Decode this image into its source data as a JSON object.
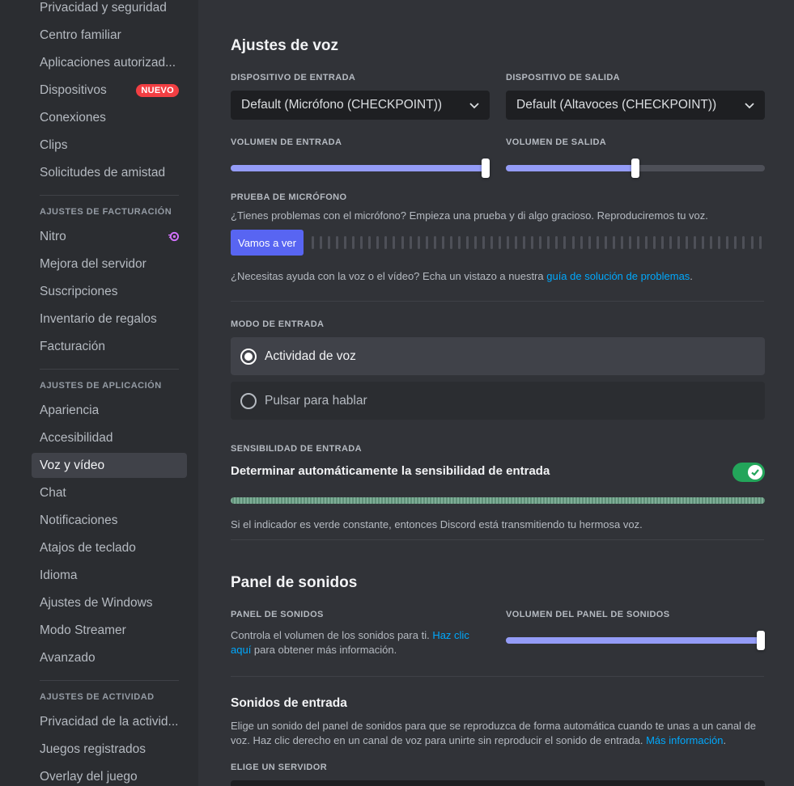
{
  "sidebar": {
    "items_top": [
      {
        "label": "Privacidad y seguridad"
      },
      {
        "label": "Centro familiar"
      },
      {
        "label": "Aplicaciones autorizad..."
      },
      {
        "label": "Dispositivos",
        "badge": "NUEVO"
      },
      {
        "label": "Conexiones"
      },
      {
        "label": "Clips"
      },
      {
        "label": "Solicitudes de amistad"
      }
    ],
    "billing_header": "AJUSTES DE FACTURACIÓN",
    "billing_items": [
      {
        "label": "Nitro",
        "icon": "nitro-icon"
      },
      {
        "label": "Mejora del servidor"
      },
      {
        "label": "Suscripciones"
      },
      {
        "label": "Inventario de regalos"
      },
      {
        "label": "Facturación"
      }
    ],
    "app_header": "AJUSTES DE APLICACIÓN",
    "app_items": [
      {
        "label": "Apariencia"
      },
      {
        "label": "Accesibilidad"
      },
      {
        "label": "Voz y vídeo",
        "active": true
      },
      {
        "label": "Chat"
      },
      {
        "label": "Notificaciones"
      },
      {
        "label": "Atajos de teclado"
      },
      {
        "label": "Idioma"
      },
      {
        "label": "Ajustes de Windows"
      },
      {
        "label": "Modo Streamer"
      },
      {
        "label": "Avanzado"
      }
    ],
    "activity_header": "AJUSTES DE ACTIVIDAD",
    "activity_items": [
      {
        "label": "Privacidad de la activid..."
      },
      {
        "label": "Juegos registrados"
      },
      {
        "label": "Overlay del juego"
      }
    ]
  },
  "voice": {
    "title": "Ajustes de voz",
    "input_device_label": "DISPOSITIVO DE ENTRADA",
    "input_device_value": "Default (Micrófono (CHECKPOINT))",
    "output_device_label": "DISPOSITIVO DE SALIDA",
    "output_device_value": "Default (Altavoces (CHECKPOINT))",
    "input_volume_label": "VOLUMEN DE ENTRADA",
    "input_volume_fraction": 1.0,
    "output_volume_label": "VOLUMEN DE SALIDA",
    "output_volume_fraction": 0.5,
    "mic_test_label": "PRUEBA DE MICRÓFONO",
    "mic_test_desc": "¿Tienes problemas con el micrófono? Empieza una prueba y di algo gracioso. Reproduciremos tu voz.",
    "mic_test_button": "Vamos a ver",
    "help_prefix": "¿Necesitas ayuda con la voz o el vídeo? Echa un vistazo a nuestra ",
    "help_link": "guía de solución de problemas",
    "help_suffix": ".",
    "input_mode_label": "MODO DE ENTRADA",
    "mode_voice_activity": "Actividad de voz",
    "mode_push_to_talk": "Pulsar para hablar",
    "sensitivity_label": "SENSIBILIDAD DE ENTRADA",
    "auto_sensitivity_text": "Determinar automáticamente la sensibilidad de entrada",
    "auto_sensitivity_on": true,
    "sensitivity_note": "Si el indicador es verde constante, entonces Discord está transmitiendo tu hermosa voz."
  },
  "soundboard": {
    "title": "Panel de sonidos",
    "panel_label": "PANEL DE SONIDOS",
    "panel_desc_prefix": "Controla el volumen de los sonidos para ti. ",
    "panel_desc_link": "Haz clic aquí",
    "panel_desc_suffix": " para obtener más información.",
    "volume_label": "VOLUMEN DEL PANEL DE SONIDOS",
    "volume_fraction": 1.0,
    "entry_sounds_title": "Sonidos de entrada",
    "entry_sounds_desc": "Elige un sonido del panel de sonidos para que se reproduzca de forma automática cuando te unas a un canal de voz. Haz clic derecho en un canal de voz para unirte sin reproducir el sonido de entrada. ",
    "entry_sounds_link": "Más información",
    "entry_sounds_suffix": ".",
    "choose_server_label": "ELIGE UN SERVIDOR"
  },
  "colors": {
    "accent": "#5865f2",
    "slider": "#949cf7",
    "toggle_on": "#23a55a",
    "link": "#00a8fc",
    "badge": "#f23f43"
  }
}
